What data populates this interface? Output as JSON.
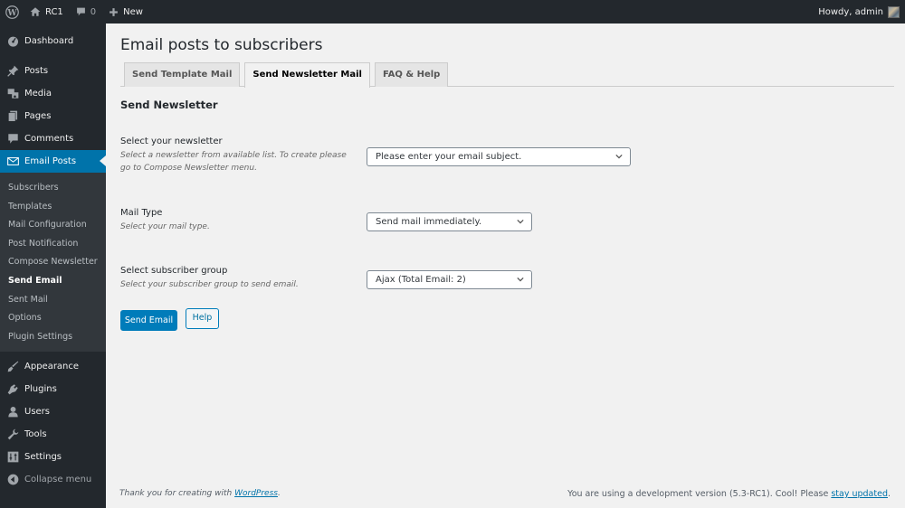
{
  "adminbar": {
    "site_name": "RC1",
    "comments_count": "0",
    "new_label": "New",
    "greeting": "Howdy, admin"
  },
  "sidebar": {
    "items_top": [
      {
        "label": "Dashboard",
        "icon": "dashboard-icon"
      },
      {
        "label": "Posts",
        "icon": "pushpin-icon"
      },
      {
        "label": "Media",
        "icon": "media-icon"
      },
      {
        "label": "Pages",
        "icon": "pages-icon"
      },
      {
        "label": "Comments",
        "icon": "comment-icon"
      },
      {
        "label": "Email Posts",
        "icon": "email-icon",
        "active": true
      }
    ],
    "submenu": [
      {
        "label": "Subscribers"
      },
      {
        "label": "Templates"
      },
      {
        "label": "Mail Configuration"
      },
      {
        "label": "Post Notification"
      },
      {
        "label": "Compose Newsletter"
      },
      {
        "label": "Send Email",
        "current": true
      },
      {
        "label": "Sent Mail"
      },
      {
        "label": "Options"
      },
      {
        "label": "Plugin Settings"
      }
    ],
    "items_bottom": [
      {
        "label": "Appearance",
        "icon": "paintbrush-icon"
      },
      {
        "label": "Plugins",
        "icon": "plugin-icon"
      },
      {
        "label": "Users",
        "icon": "user-icon"
      },
      {
        "label": "Tools",
        "icon": "wrench-icon"
      },
      {
        "label": "Settings",
        "icon": "settings-icon"
      }
    ],
    "collapse_label": "Collapse menu"
  },
  "page": {
    "title": "Email posts to subscribers",
    "tabs": [
      {
        "label": "Send Template Mail"
      },
      {
        "label": "Send Newsletter Mail",
        "active": true
      },
      {
        "label": "FAQ & Help"
      }
    ],
    "section_title": "Send Newsletter",
    "fields": [
      {
        "label": "Select your newsletter",
        "description": "Select a newsletter from available list. To create please go to Compose Newsletter menu.",
        "selected": "Please enter your email subject."
      },
      {
        "label": "Mail Type",
        "description": "Select your mail type.",
        "selected": "Send mail immediately."
      },
      {
        "label": "Select subscriber group",
        "description": "Select your subscriber group to send email.",
        "selected": "Ajax (Total Email: 2)"
      }
    ],
    "send_button": "Send Email",
    "help_button": "Help"
  },
  "footer": {
    "thanks_prefix": "Thank you for creating with ",
    "thanks_link": "WordPress",
    "thanks_suffix": ".",
    "version_prefix": "You are using a development version (5.3-RC1). Cool! Please ",
    "version_link": "stay updated",
    "version_suffix": "."
  },
  "colors": {
    "admin_dark": "#23282d",
    "submenu_bg": "#32373c",
    "accent": "#0073aa",
    "button_primary": "#007cba",
    "page_bg": "#f1f1f1"
  }
}
